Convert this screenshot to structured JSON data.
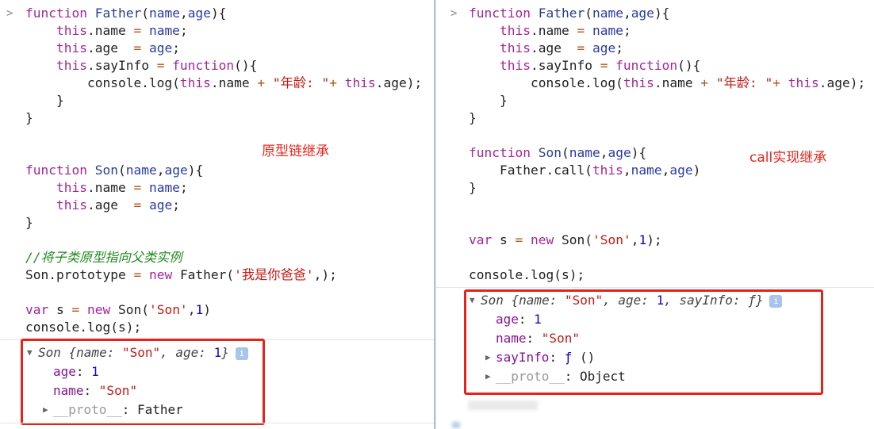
{
  "left": {
    "annotation": "原型链继承",
    "code": [
      [
        [
          "function ",
          "kw"
        ],
        [
          "Father",
          "def"
        ],
        [
          "(",
          "txt"
        ],
        [
          "name",
          "var"
        ],
        [
          ",",
          "txt"
        ],
        [
          "age",
          "var"
        ],
        [
          "){",
          "txt"
        ]
      ],
      [
        [
          "    this",
          "kw"
        ],
        [
          ".name ",
          "txt"
        ],
        [
          "=",
          "op"
        ],
        [
          " name",
          "var"
        ],
        [
          ";",
          "txt"
        ]
      ],
      [
        [
          "    this",
          "kw"
        ],
        [
          ".age  ",
          "txt"
        ],
        [
          "=",
          "op"
        ],
        [
          " age",
          "var"
        ],
        [
          ";",
          "txt"
        ]
      ],
      [
        [
          "    this",
          "kw"
        ],
        [
          ".sayInfo ",
          "txt"
        ],
        [
          "=",
          "op"
        ],
        [
          " function",
          "kw"
        ],
        [
          "(){",
          "txt"
        ]
      ],
      [
        [
          "        console.log(",
          "txt"
        ],
        [
          "this",
          "kw"
        ],
        [
          ".name ",
          "txt"
        ],
        [
          "+",
          "op"
        ],
        [
          " \"年龄: \"",
          "str"
        ],
        [
          "+",
          "op"
        ],
        [
          " this",
          "kw"
        ],
        [
          ".age);",
          "txt"
        ]
      ],
      [
        [
          "    }",
          "txt"
        ]
      ],
      [
        [
          "}",
          "txt"
        ]
      ],
      [],
      [],
      [
        [
          "function ",
          "kw"
        ],
        [
          "Son",
          "def"
        ],
        [
          "(",
          "txt"
        ],
        [
          "name",
          "var"
        ],
        [
          ",",
          "txt"
        ],
        [
          "age",
          "var"
        ],
        [
          "){",
          "txt"
        ]
      ],
      [
        [
          "    this",
          "kw"
        ],
        [
          ".name ",
          "txt"
        ],
        [
          "=",
          "op"
        ],
        [
          " name",
          "var"
        ],
        [
          ";",
          "txt"
        ]
      ],
      [
        [
          "    this",
          "kw"
        ],
        [
          ".age  ",
          "txt"
        ],
        [
          "=",
          "op"
        ],
        [
          " age",
          "var"
        ],
        [
          ";",
          "txt"
        ]
      ],
      [
        [
          "}",
          "txt"
        ]
      ],
      [],
      [
        [
          "//将子类原型指向父类实例",
          "cm"
        ]
      ],
      [
        [
          "Son.prototype ",
          "txt"
        ],
        [
          "=",
          "op"
        ],
        [
          " new ",
          "kw"
        ],
        [
          "Father(",
          "txt"
        ],
        [
          "'我是你爸爸'",
          "str"
        ],
        [
          ",);",
          "txt"
        ]
      ],
      [],
      [
        [
          "var ",
          "kw"
        ],
        [
          "s ",
          "txt"
        ],
        [
          "=",
          "op"
        ],
        [
          " new ",
          "kw"
        ],
        [
          "Son(",
          "txt"
        ],
        [
          "'Son'",
          "str"
        ],
        [
          ",",
          "txt"
        ],
        [
          "1",
          "num"
        ],
        [
          ")",
          "txt"
        ]
      ],
      [
        [
          "console.log(s);",
          "txt"
        ]
      ]
    ],
    "output": {
      "summary": [
        [
          "Son ",
          "it"
        ],
        [
          "{name: ",
          "it"
        ],
        [
          "\"Son\"",
          "str"
        ],
        [
          ", age: ",
          "it"
        ],
        [
          "1",
          "num"
        ],
        [
          "}",
          "it"
        ]
      ],
      "props": [
        [
          [
            "age",
            "key"
          ],
          [
            ": ",
            "txt"
          ],
          [
            "1",
            "num"
          ]
        ],
        [
          [
            "name",
            "key"
          ],
          [
            ": ",
            "txt"
          ],
          [
            "\"Son\"",
            "str"
          ]
        ],
        [
          [
            "__proto__",
            "dim"
          ],
          [
            ": Father",
            "txt"
          ]
        ]
      ]
    }
  },
  "right": {
    "annotation": "call实现继承",
    "code": [
      [
        [
          "function ",
          "kw"
        ],
        [
          "Father",
          "def"
        ],
        [
          "(",
          "txt"
        ],
        [
          "name",
          "var"
        ],
        [
          ",",
          "txt"
        ],
        [
          "age",
          "var"
        ],
        [
          "){",
          "txt"
        ]
      ],
      [
        [
          "    this",
          "kw"
        ],
        [
          ".name ",
          "txt"
        ],
        [
          "=",
          "op"
        ],
        [
          " name",
          "var"
        ],
        [
          ";",
          "txt"
        ]
      ],
      [
        [
          "    this",
          "kw"
        ],
        [
          ".age  ",
          "txt"
        ],
        [
          "=",
          "op"
        ],
        [
          " age",
          "var"
        ],
        [
          ";",
          "txt"
        ]
      ],
      [
        [
          "    this",
          "kw"
        ],
        [
          ".sayInfo ",
          "txt"
        ],
        [
          "=",
          "op"
        ],
        [
          " function",
          "kw"
        ],
        [
          "(){",
          "txt"
        ]
      ],
      [
        [
          "        console.log(",
          "txt"
        ],
        [
          "this",
          "kw"
        ],
        [
          ".name ",
          "txt"
        ],
        [
          "+",
          "op"
        ],
        [
          " \"年龄: \"",
          "str"
        ],
        [
          "+",
          "op"
        ],
        [
          " this",
          "kw"
        ],
        [
          ".age);",
          "txt"
        ]
      ],
      [
        [
          "    }",
          "txt"
        ]
      ],
      [
        [
          "}",
          "txt"
        ]
      ],
      [],
      [
        [
          "function ",
          "kw"
        ],
        [
          "Son",
          "def"
        ],
        [
          "(",
          "txt"
        ],
        [
          "name",
          "var"
        ],
        [
          ",",
          "txt"
        ],
        [
          "age",
          "var"
        ],
        [
          "){",
          "txt"
        ]
      ],
      [
        [
          "    Father.call(",
          "txt"
        ],
        [
          "this",
          "kw"
        ],
        [
          ",",
          "txt"
        ],
        [
          "name",
          "var"
        ],
        [
          ",",
          "txt"
        ],
        [
          "age",
          "var"
        ],
        [
          ")",
          "txt"
        ]
      ],
      [
        [
          "}",
          "txt"
        ]
      ],
      [],
      [],
      [
        [
          "var ",
          "kw"
        ],
        [
          "s ",
          "txt"
        ],
        [
          "=",
          "op"
        ],
        [
          " new ",
          "kw"
        ],
        [
          "Son(",
          "txt"
        ],
        [
          "'Son'",
          "str"
        ],
        [
          ",",
          "txt"
        ],
        [
          "1",
          "num"
        ],
        [
          ");",
          "txt"
        ]
      ],
      [],
      [
        [
          "console.log(s);",
          "txt"
        ]
      ]
    ],
    "output": {
      "summary": [
        [
          "Son ",
          "it"
        ],
        [
          "{name: ",
          "it"
        ],
        [
          "\"Son\"",
          "str"
        ],
        [
          ", age: ",
          "it"
        ],
        [
          "1",
          "num"
        ],
        [
          ", sayInfo: ",
          "it"
        ],
        [
          "ƒ",
          "it"
        ],
        [
          "}",
          "it"
        ]
      ],
      "props": [
        [
          [
            "age",
            "key"
          ],
          [
            ": ",
            "txt"
          ],
          [
            "1",
            "num"
          ]
        ],
        [
          [
            "name",
            "key"
          ],
          [
            ": ",
            "txt"
          ],
          [
            "\"Son\"",
            "str"
          ]
        ],
        [
          [
            "sayInfo",
            "key"
          ],
          [
            ": ",
            "txt"
          ],
          [
            "ƒ",
            "num"
          ],
          [
            " ()",
            "txt"
          ]
        ],
        [
          [
            "__proto__",
            "dim"
          ],
          [
            ": Object",
            "txt"
          ]
        ]
      ]
    }
  },
  "icons": {
    "prompt": "chevron-right-icon",
    "expanded": "triangle-down-icon",
    "collapsed": "triangle-right-icon",
    "info": "info-icon"
  },
  "colors": {
    "annotation": "#e3231c",
    "keyword": "#a3269a",
    "string": "#c41a16"
  }
}
